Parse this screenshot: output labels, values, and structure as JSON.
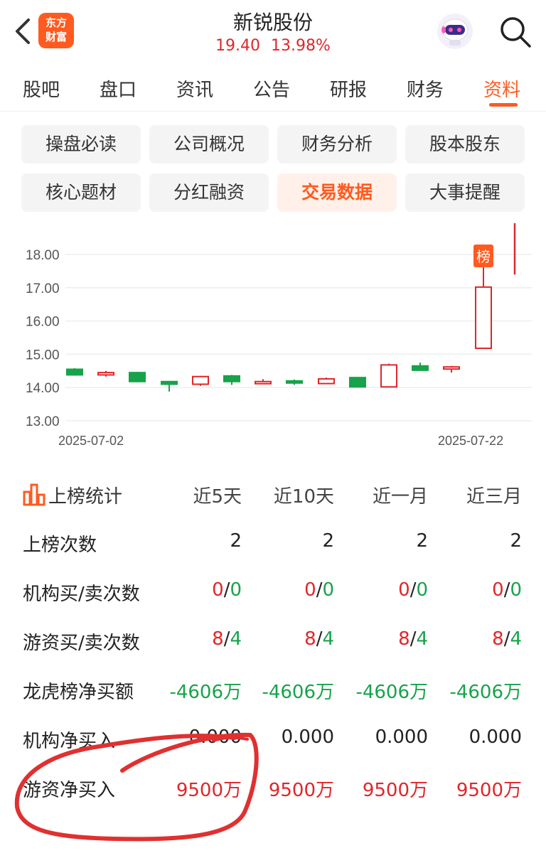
{
  "header": {
    "logo_line1": "东方",
    "logo_line2": "财富",
    "stock_name": "新锐股份",
    "price": "19.40",
    "change_pct": "13.98%"
  },
  "tabs": [
    {
      "label": "股吧"
    },
    {
      "label": "盘口"
    },
    {
      "label": "资讯"
    },
    {
      "label": "公告"
    },
    {
      "label": "研报"
    },
    {
      "label": "财务"
    },
    {
      "label": "资料"
    }
  ],
  "active_tab": "资料",
  "subtabs": [
    {
      "label": "操盘必读"
    },
    {
      "label": "公司概况"
    },
    {
      "label": "财务分析"
    },
    {
      "label": "股本股东"
    },
    {
      "label": "核心题材"
    },
    {
      "label": "分红融资"
    },
    {
      "label": "交易数据"
    },
    {
      "label": "大事提醒"
    }
  ],
  "active_subtab": "交易数据",
  "chart_data": {
    "type": "candlestick",
    "y_ticks": [
      "18.00",
      "17.00",
      "16.00",
      "15.00",
      "14.00",
      "13.00"
    ],
    "ylim": [
      12.7,
      19.0
    ],
    "x_labels": [
      "2025-07-02",
      "2025-07-22"
    ],
    "marker_label": "榜",
    "candles": [
      {
        "open": 14.38,
        "close": 14.55,
        "high": 14.58,
        "low": 14.36,
        "color": "green"
      },
      {
        "open": 14.38,
        "close": 14.45,
        "high": 14.5,
        "low": 14.33,
        "color": "red"
      },
      {
        "open": 14.45,
        "close": 14.18,
        "high": 14.47,
        "low": 14.16,
        "color": "green"
      },
      {
        "open": 14.18,
        "close": 14.1,
        "high": 14.2,
        "low": 13.88,
        "color": "green"
      },
      {
        "open": 14.1,
        "close": 14.33,
        "high": 14.35,
        "low": 14.05,
        "color": "red"
      },
      {
        "open": 14.35,
        "close": 14.18,
        "high": 14.38,
        "low": 14.08,
        "color": "green"
      },
      {
        "open": 14.12,
        "close": 14.18,
        "high": 14.25,
        "low": 14.1,
        "color": "red"
      },
      {
        "open": 14.2,
        "close": 14.15,
        "high": 14.24,
        "low": 14.08,
        "color": "green"
      },
      {
        "open": 14.12,
        "close": 14.26,
        "high": 14.3,
        "low": 14.1,
        "color": "red"
      },
      {
        "open": 14.3,
        "close": 14.02,
        "high": 14.3,
        "low": 14.0,
        "color": "green"
      },
      {
        "open": 14.02,
        "close": 14.68,
        "high": 14.72,
        "low": 14.0,
        "color": "red"
      },
      {
        "open": 14.65,
        "close": 14.52,
        "high": 14.75,
        "low": 14.5,
        "color": "green"
      },
      {
        "open": 14.6,
        "close": 14.62,
        "high": 14.65,
        "low": 14.45,
        "color": "red"
      },
      {
        "open": 15.18,
        "close": 17.02,
        "high": 17.5,
        "low": 15.18,
        "color": "red"
      },
      {
        "open": 17.4,
        "close": 19.0,
        "high": 19.0,
        "low": 17.4,
        "color": "red"
      }
    ]
  },
  "stats": {
    "title": "上榜统计",
    "columns": [
      "近5天",
      "近10天",
      "近一月",
      "近三月"
    ],
    "rows": [
      {
        "label": "上榜次数",
        "values": [
          [
            "2"
          ],
          [
            "2"
          ],
          [
            "2"
          ],
          [
            "2"
          ]
        ]
      },
      {
        "label": "机构买/卖次数",
        "values": [
          [
            "0",
            "/",
            "0"
          ],
          [
            "0",
            "/",
            "0"
          ],
          [
            "0",
            "/",
            "0"
          ],
          [
            "0",
            "/",
            "0"
          ]
        ]
      },
      {
        "label": "游资买/卖次数",
        "values": [
          [
            "8",
            "/",
            "4"
          ],
          [
            "8",
            "/",
            "4"
          ],
          [
            "8",
            "/",
            "4"
          ],
          [
            "8",
            "/",
            "4"
          ]
        ]
      },
      {
        "label": "龙虎榜净买额",
        "values": [
          [
            "-4606万"
          ],
          [
            "-4606万"
          ],
          [
            "-4606万"
          ],
          [
            "-4606万"
          ]
        ]
      },
      {
        "label": "机构净买入",
        "values": [
          [
            "0.000"
          ],
          [
            "0.000"
          ],
          [
            "0.000"
          ],
          [
            "0.000"
          ]
        ]
      },
      {
        "label": "游资净买入",
        "values": [
          [
            "9500万"
          ],
          [
            "9500万"
          ],
          [
            "9500万"
          ],
          [
            "9500万"
          ]
        ]
      }
    ]
  },
  "colors": {
    "accent": "#ff5a1f",
    "up": "#e0262a",
    "down": "#17a34a",
    "annotation": "#e03030"
  }
}
